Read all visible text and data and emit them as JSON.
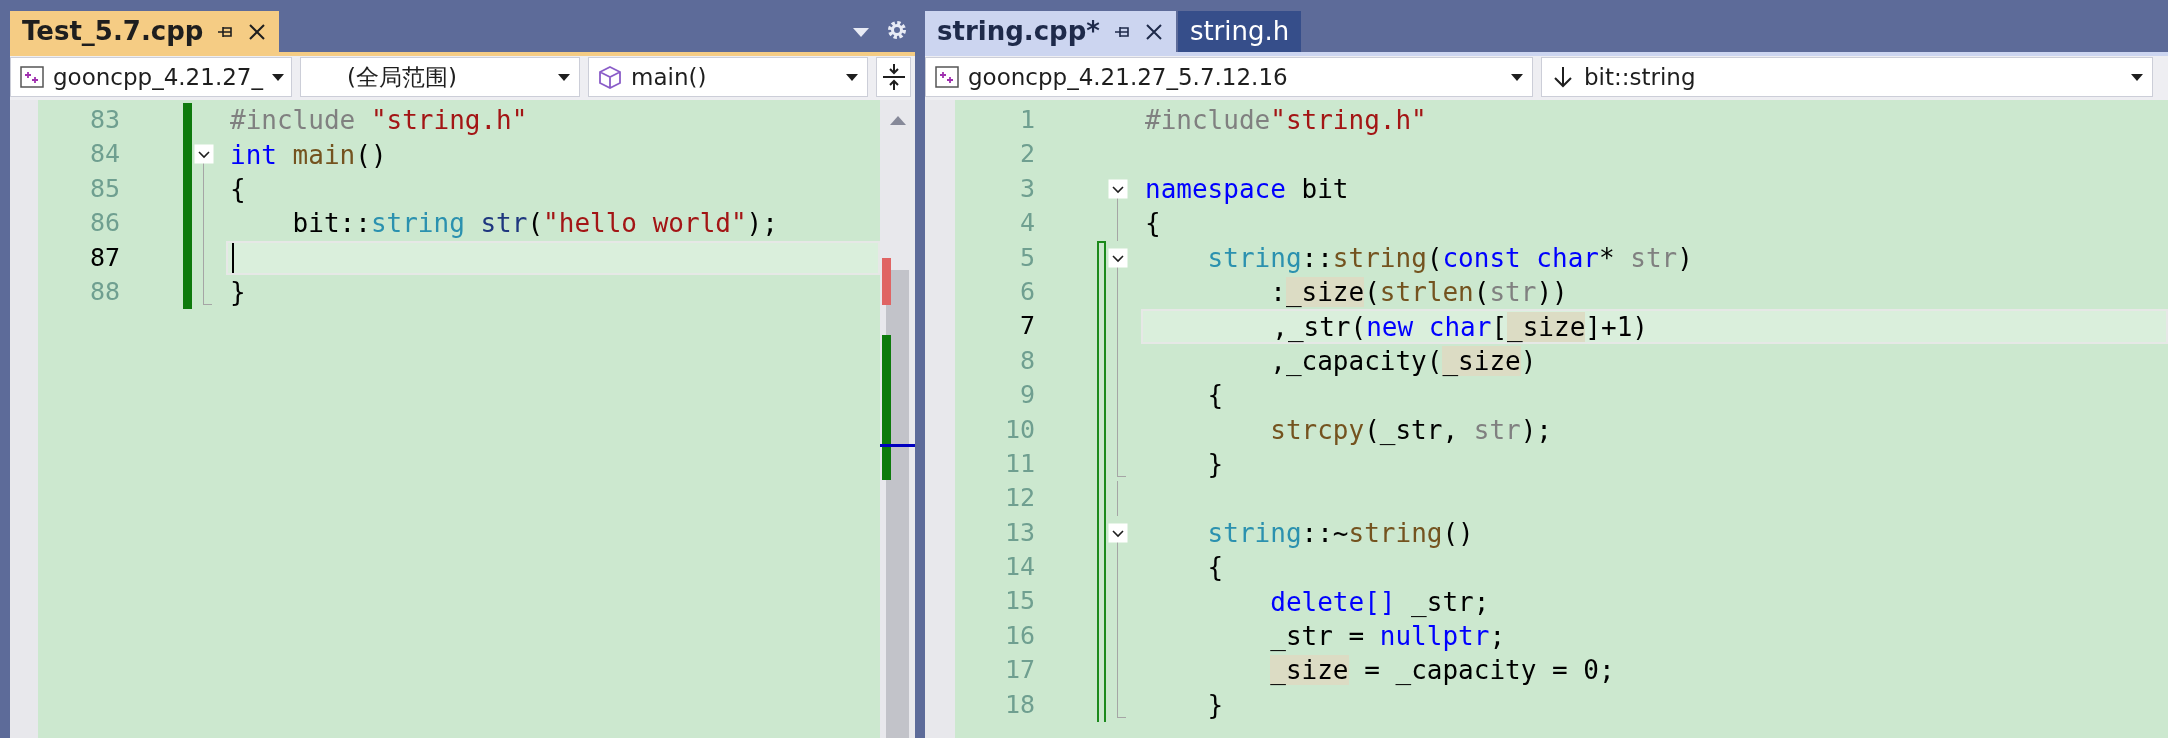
{
  "left_group": {
    "active": true,
    "tabs": [
      {
        "label": "Test_5.7.cpp",
        "selected": true
      }
    ],
    "nav": {
      "project": "gooncpp_4.21.27_",
      "scope": "(全局范围)",
      "member": "main()"
    },
    "editor": {
      "lines": [
        {
          "number": "83",
          "current": false,
          "change_marker": {
            "outlined": false
          },
          "tokens": [
            {
              "kind": "preproc",
              "text": "#include "
            },
            {
              "kind": "string",
              "text": "\"string.h\""
            }
          ]
        },
        {
          "number": "84",
          "current": false,
          "change_marker": {
            "outlined": false
          },
          "fold_marker": {
            "kind": "start"
          },
          "tokens": [
            {
              "kind": "keyword",
              "text": "int"
            },
            {
              "kind": "func",
              "text": " main"
            },
            {
              "kind": "plain",
              "text": "()"
            }
          ]
        },
        {
          "number": "85",
          "current": false,
          "change_marker": {
            "outlined": false
          },
          "fold_marker": {
            "kind": "inside"
          },
          "tokens": [
            {
              "kind": "plain",
              "text": "{"
            }
          ]
        },
        {
          "number": "86",
          "current": false,
          "change_marker": {
            "outlined": false
          },
          "fold_marker": {
            "kind": "inside"
          },
          "tokens": [
            {
              "kind": "plain",
              "text": "    bit::"
            },
            {
              "kind": "type",
              "text": "string"
            },
            {
              "kind": "variable",
              "text": " str"
            },
            {
              "kind": "plain",
              "text": "("
            },
            {
              "kind": "string",
              "text": "\"hello world\""
            },
            {
              "kind": "plain",
              "text": ");"
            }
          ]
        },
        {
          "number": "87",
          "current": true,
          "change_marker": {
            "outlined": false
          },
          "fold_marker": {
            "kind": "inside"
          }
        },
        {
          "number": "88",
          "current": false,
          "change_marker": {
            "outlined": false
          },
          "fold_marker": {
            "kind": "end"
          },
          "tokens": [
            {
              "kind": "plain",
              "text": "}"
            }
          ]
        }
      ]
    }
  },
  "right_group": {
    "active": false,
    "tabs": [
      {
        "label": "string.cpp*",
        "selected": true
      },
      {
        "label": "string.h",
        "selected": false
      }
    ],
    "nav": {
      "project": "gooncpp_4.21.27_5.7.12.16",
      "scope": "bit::string"
    },
    "editor": {
      "lines": [
        {
          "number": "1",
          "current": false,
          "tokens": [
            {
              "kind": "preproc",
              "text": "#include"
            },
            {
              "kind": "string",
              "text": "\"string.h\""
            }
          ]
        },
        {
          "number": "2",
          "current": false
        },
        {
          "number": "3",
          "current": false,
          "fold_marker": {
            "kind": "start"
          },
          "tokens": [
            {
              "kind": "keyword",
              "text": "namespace"
            },
            {
              "kind": "plain",
              "text": " bit"
            }
          ]
        },
        {
          "number": "4",
          "current": false,
          "fold_marker": {
            "kind": "inside"
          },
          "tokens": [
            {
              "kind": "plain",
              "text": "{"
            }
          ]
        },
        {
          "number": "5",
          "current": false,
          "change_marker": {
            "outlined": true
          },
          "fold_marker": {
            "kind": "start"
          },
          "tokens": [
            {
              "kind": "type",
              "text": "    string"
            },
            {
              "kind": "plain",
              "text": "::"
            },
            {
              "kind": "func",
              "text": "string"
            },
            {
              "kind": "plain",
              "text": "("
            },
            {
              "kind": "keyword",
              "text": "const"
            },
            {
              "kind": "keyword",
              "text": " char"
            },
            {
              "kind": "plain",
              "text": "* "
            },
            {
              "kind": "param",
              "text": "str"
            },
            {
              "kind": "plain",
              "text": ")"
            }
          ]
        },
        {
          "number": "6",
          "current": false,
          "change_marker": {
            "outlined": true
          },
          "fold_marker": {
            "kind": "inside"
          },
          "tokens": [
            {
              "kind": "plain",
              "text": "        :"
            },
            {
              "kind": "plain",
              "text": "_size",
              "highlight": true
            },
            {
              "kind": "plain",
              "text": "("
            },
            {
              "kind": "func",
              "text": "strlen"
            },
            {
              "kind": "plain",
              "text": "("
            },
            {
              "kind": "param",
              "text": "str"
            },
            {
              "kind": "plain",
              "text": "))"
            }
          ]
        },
        {
          "number": "7",
          "current": true,
          "change_marker": {
            "outlined": true
          },
          "fold_marker": {
            "kind": "inside"
          },
          "tokens": [
            {
              "kind": "plain",
              "text": "        ,_str("
            },
            {
              "kind": "keyword",
              "text": "new"
            },
            {
              "kind": "keyword",
              "text": " char"
            },
            {
              "kind": "plain",
              "text": "["
            },
            {
              "kind": "plain",
              "text": "_size",
              "highlight": true
            },
            {
              "kind": "plain",
              "text": "]+1)"
            }
          ]
        },
        {
          "number": "8",
          "current": false,
          "change_marker": {
            "outlined": true
          },
          "fold_marker": {
            "kind": "inside"
          },
          "tokens": [
            {
              "kind": "plain",
              "text": "        ,_capacity("
            },
            {
              "kind": "plain",
              "text": "_size",
              "highlight": true
            },
            {
              "kind": "plain",
              "text": ")"
            }
          ]
        },
        {
          "number": "9",
          "current": false,
          "change_marker": {
            "outlined": true
          },
          "fold_marker": {
            "kind": "inside"
          },
          "tokens": [
            {
              "kind": "plain",
              "text": "    {"
            }
          ]
        },
        {
          "number": "10",
          "current": false,
          "change_marker": {
            "outlined": true
          },
          "fold_marker": {
            "kind": "inside"
          },
          "tokens": [
            {
              "kind": "func",
              "text": "        strcpy"
            },
            {
              "kind": "plain",
              "text": "(_str, "
            },
            {
              "kind": "param",
              "text": "str"
            },
            {
              "kind": "plain",
              "text": ");"
            }
          ]
        },
        {
          "number": "11",
          "current": false,
          "change_marker": {
            "outlined": true
          },
          "fold_marker": {
            "kind": "end"
          },
          "tokens": [
            {
              "kind": "plain",
              "text": "    }"
            }
          ]
        },
        {
          "number": "12",
          "current": false,
          "change_marker": {
            "outlined": true
          },
          "fold_marker": {
            "kind": "inside"
          }
        },
        {
          "number": "13",
          "current": false,
          "change_marker": {
            "outlined": true
          },
          "fold_marker": {
            "kind": "start"
          },
          "tokens": [
            {
              "kind": "type",
              "text": "    string"
            },
            {
              "kind": "plain",
              "text": "::~"
            },
            {
              "kind": "func",
              "text": "string"
            },
            {
              "kind": "plain",
              "text": "()"
            }
          ]
        },
        {
          "number": "14",
          "current": false,
          "change_marker": {
            "outlined": true
          },
          "fold_marker": {
            "kind": "inside"
          },
          "tokens": [
            {
              "kind": "plain",
              "text": "    {"
            }
          ]
        },
        {
          "number": "15",
          "current": false,
          "change_marker": {
            "outlined": true
          },
          "fold_marker": {
            "kind": "inside"
          },
          "tokens": [
            {
              "kind": "keyword",
              "text": "        delete[]"
            },
            {
              "kind": "plain",
              "text": " _str;"
            }
          ]
        },
        {
          "number": "16",
          "current": false,
          "change_marker": {
            "outlined": true
          },
          "fold_marker": {
            "kind": "inside"
          },
          "tokens": [
            {
              "kind": "plain",
              "text": "        _str = "
            },
            {
              "kind": "keyword",
              "text": "nullptr"
            },
            {
              "kind": "plain",
              "text": ";"
            }
          ]
        },
        {
          "number": "17",
          "current": false,
          "change_marker": {
            "outlined": true
          },
          "fold_marker": {
            "kind": "inside"
          },
          "tokens": [
            {
              "kind": "plain",
              "text": "        _size",
              "highlight": true
            },
            {
              "kind": "plain",
              "text": " = _capacity = 0;"
            }
          ]
        },
        {
          "number": "18",
          "current": false,
          "change_marker": {
            "outlined": true
          },
          "fold_marker": {
            "kind": "end"
          },
          "tokens": [
            {
              "kind": "plain",
              "text": "    }"
            }
          ]
        }
      ]
    }
  }
}
